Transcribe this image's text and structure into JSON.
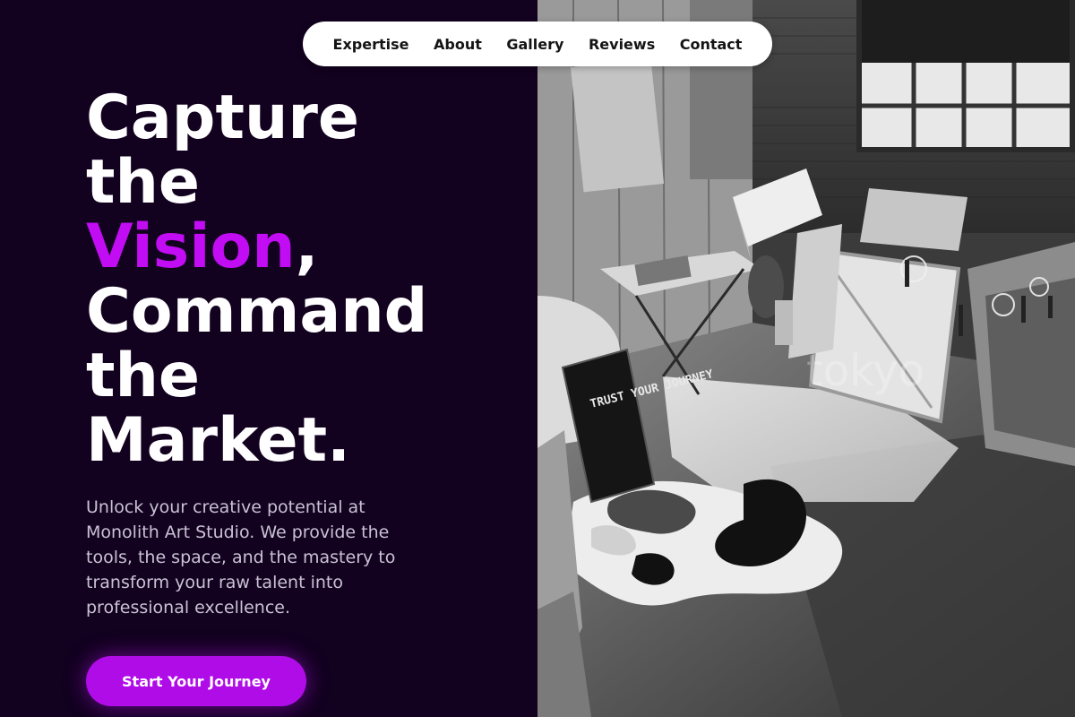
{
  "nav": {
    "items": [
      {
        "label": "Expertise"
      },
      {
        "label": "About"
      },
      {
        "label": "Gallery"
      },
      {
        "label": "Reviews"
      },
      {
        "label": "Contact"
      }
    ]
  },
  "hero": {
    "headline": {
      "line1": "Capture",
      "line2": "the",
      "line3_accent": "Vision",
      "line3_rest": ",",
      "line4": "Command",
      "line5": "the",
      "line6": "Market."
    },
    "description": "Unlock your creative potential at Monolith Art Studio. We provide the tools, the space, and the mastery to transform your raw talent into professional excellence.",
    "cta_label": "Start Your Journey"
  },
  "image": {
    "sign_text": "TRUST YOUR JOURNEY",
    "watermark": "tokyo"
  },
  "colors": {
    "background": "#12011f",
    "accent": "#c20cf3",
    "button": "#b00ce8",
    "nav_background": "#ffffff"
  }
}
